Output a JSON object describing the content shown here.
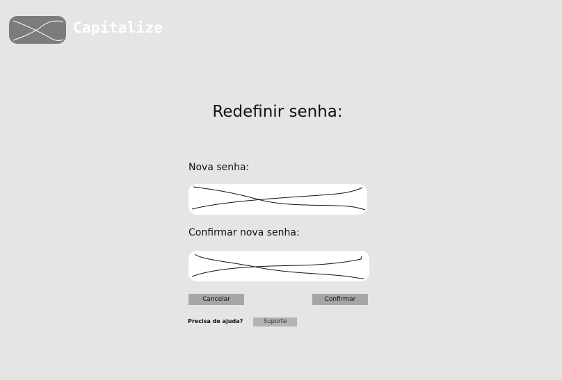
{
  "header": {
    "logo_icon": "placeholder-image-icon",
    "brand": "Capitalize"
  },
  "main": {
    "title": "Redefinir senha:",
    "new_password": {
      "label": "Nova senha:",
      "value": ""
    },
    "confirm_password": {
      "label": "Confirmar nova senha:",
      "value": ""
    },
    "cancel_label": "Cancelar",
    "confirm_label": "Confirmar"
  },
  "help": {
    "text": "Precisa de ajuda?",
    "support_label": "Suporte"
  },
  "colors": {
    "background": "#e5e5e5",
    "logo_box": "#7c7c7c",
    "button": "#a6a6a6",
    "field": "#ffffff"
  }
}
